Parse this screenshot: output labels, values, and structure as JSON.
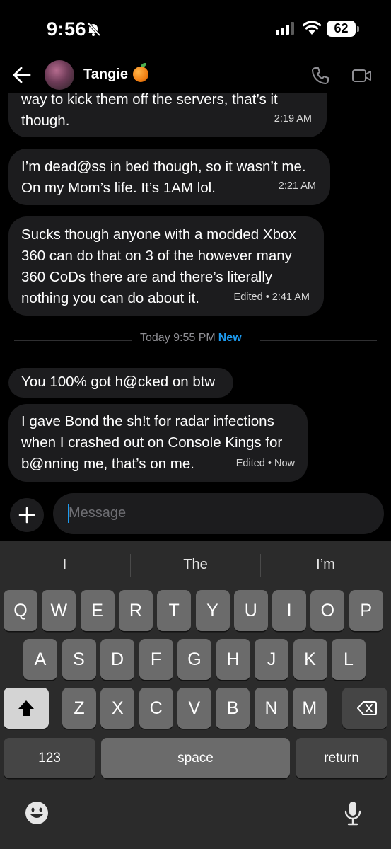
{
  "status_bar": {
    "time": "9:56",
    "battery": "62"
  },
  "header": {
    "contact_name": "Tangie"
  },
  "messages": [
    {
      "lines": [
        "way to kick them off the servers, that’s it",
        "though."
      ],
      "meta": "2:19 AM"
    },
    {
      "lines": [
        "I’m dead@ss in bed though, so it wasn’t me.",
        "On my Mom’s life. It’s 1AM lol."
      ],
      "meta": "2:21 AM"
    },
    {
      "lines": [
        "Sucks though anyone with a modded Xbox",
        "360 can do that on 3 of the however many",
        "360 CoDs there are and there’s literally",
        "nothing you can do about it."
      ],
      "meta": "Edited • 2:41 AM"
    },
    {
      "lines": [
        "You 100% got h@cked on btw"
      ],
      "meta": ""
    },
    {
      "lines": [
        "I gave Bond the sh!t for radar infections",
        "when I crashed out on Console Kings for",
        "b@nning me, that’s on me."
      ],
      "meta": "Edited • Now"
    }
  ],
  "divider": {
    "label": "Today 9:55 PM",
    "new_label": "New"
  },
  "composer": {
    "placeholder": "Message"
  },
  "keyboard": {
    "suggestions": [
      "I",
      "The",
      "I’m"
    ],
    "row1": [
      "Q",
      "W",
      "E",
      "R",
      "T",
      "Y",
      "U",
      "I",
      "O",
      "P"
    ],
    "row2": [
      "A",
      "S",
      "D",
      "F",
      "G",
      "H",
      "J",
      "K",
      "L"
    ],
    "row3": [
      "Z",
      "X",
      "C",
      "V",
      "B",
      "N",
      "M"
    ],
    "numbers_label": "123",
    "space_label": "space",
    "return_label": "return"
  }
}
